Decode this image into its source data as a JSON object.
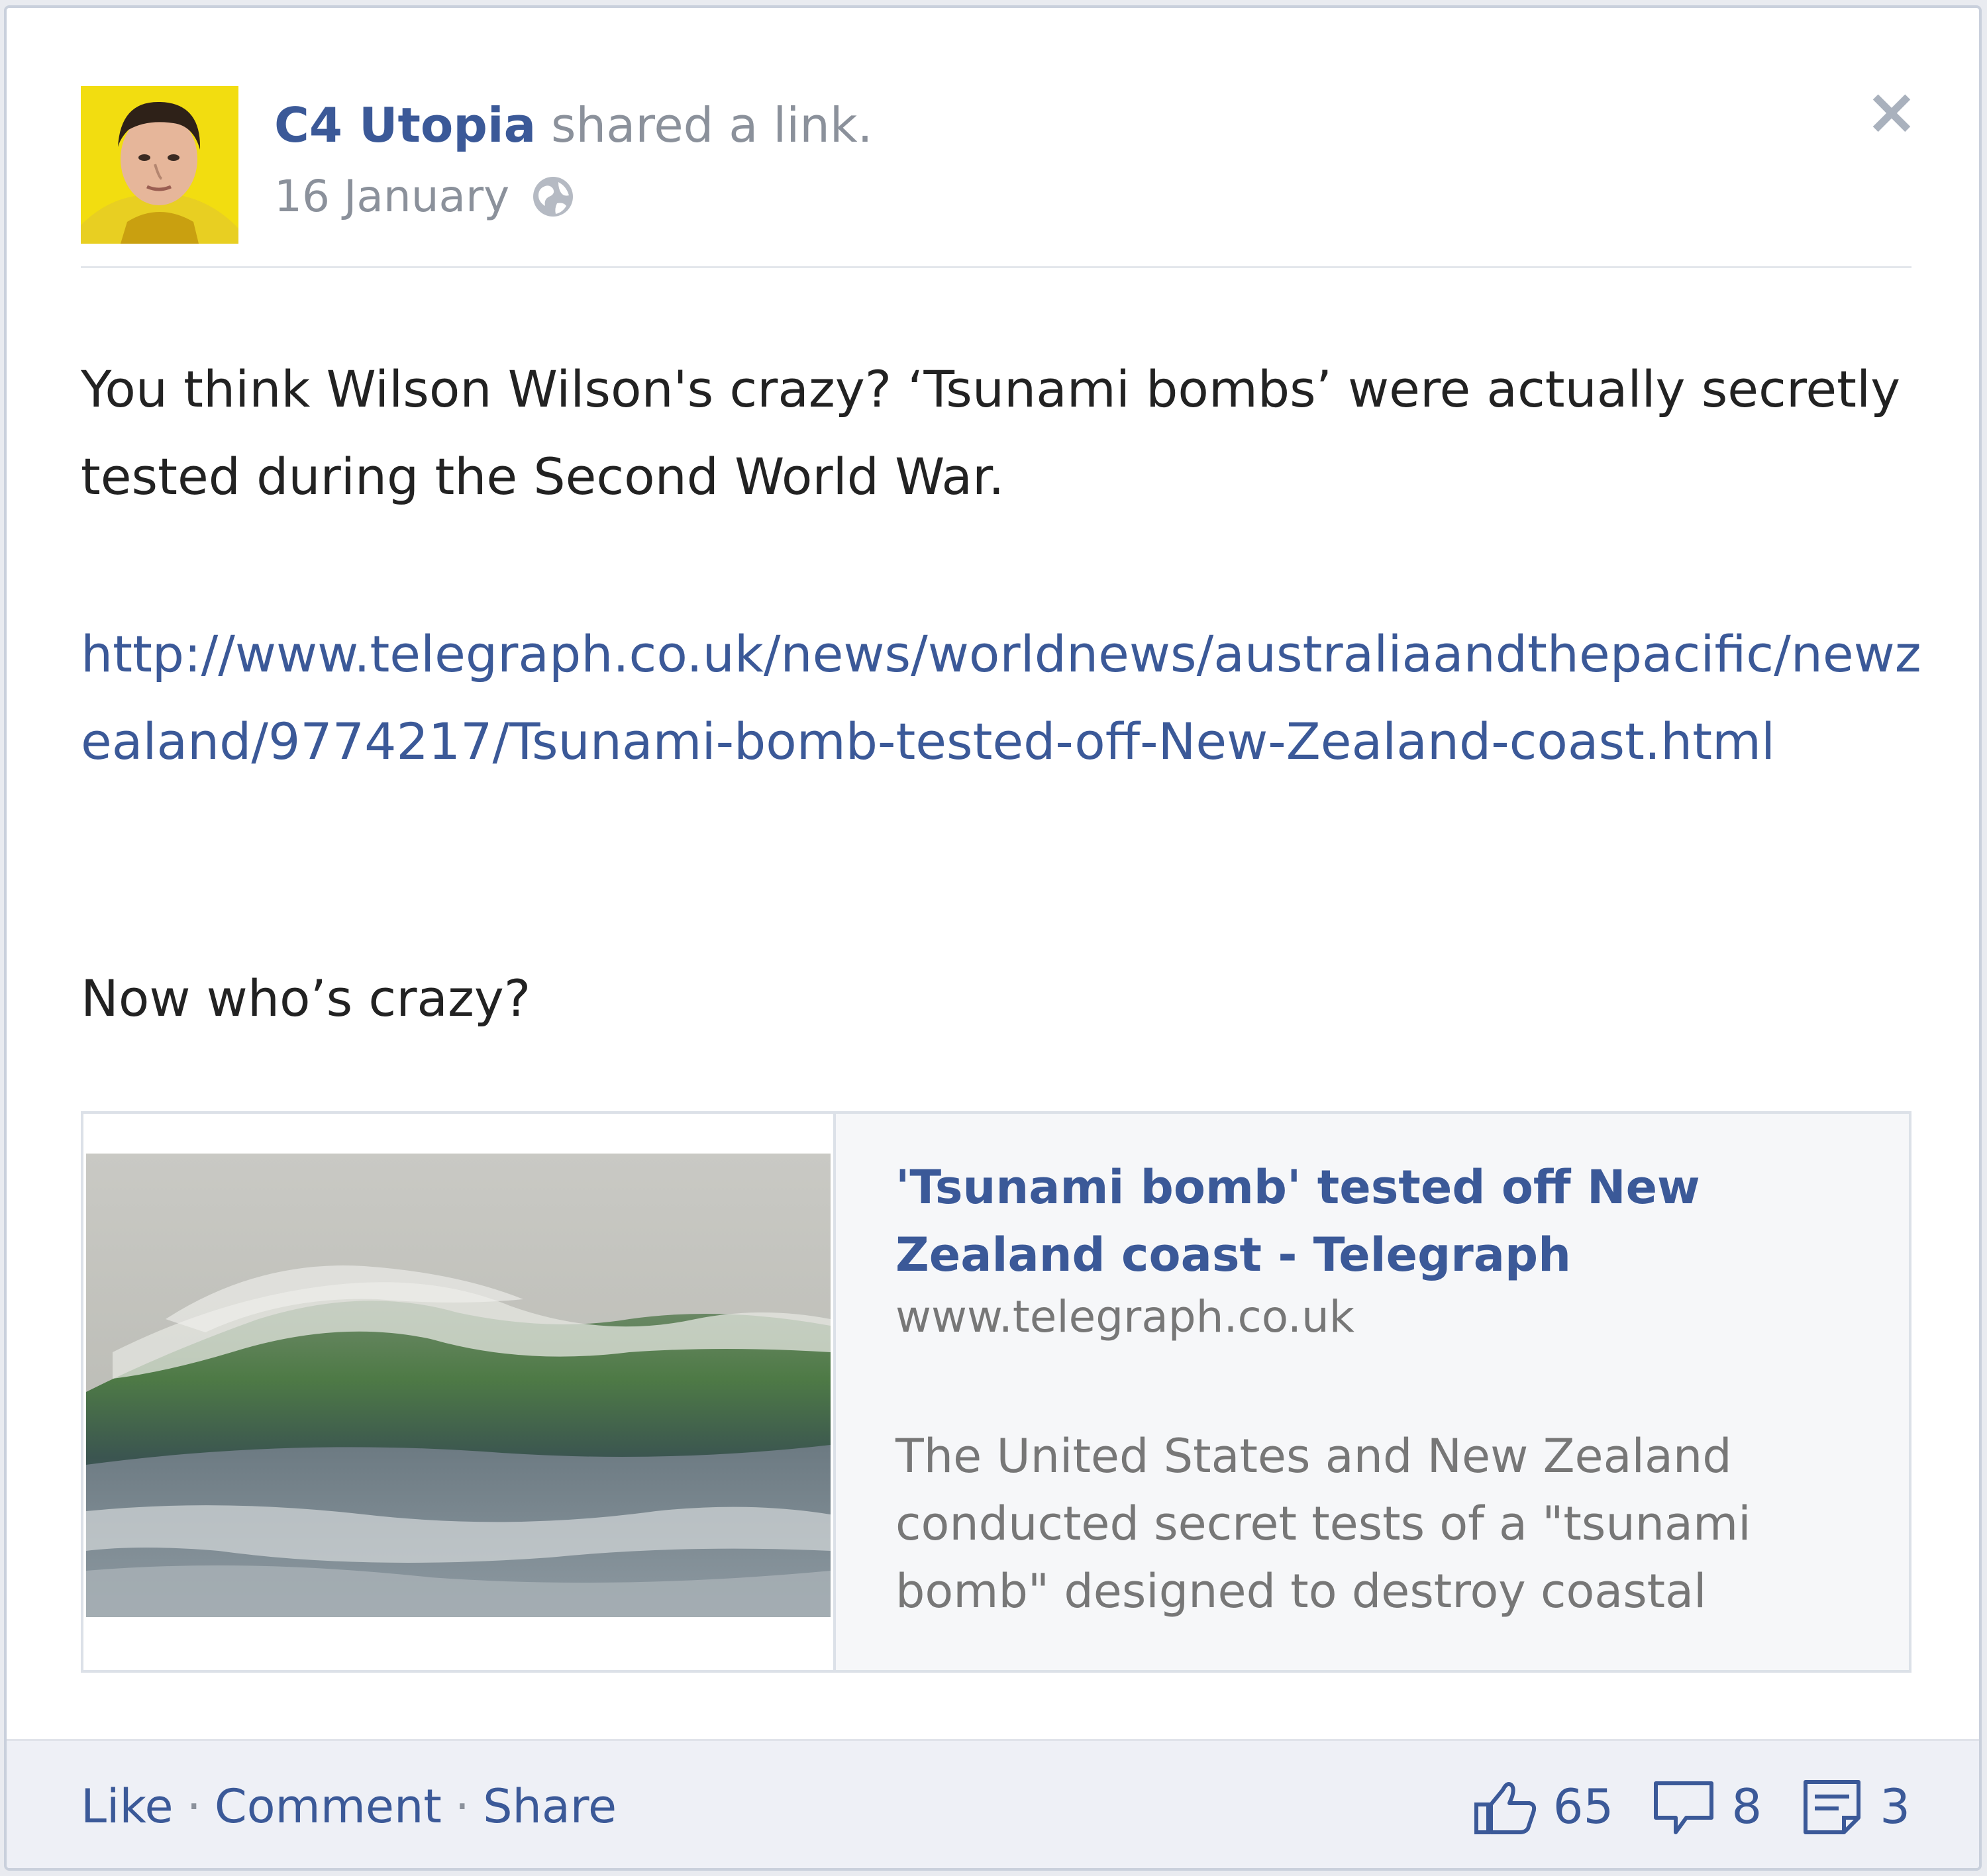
{
  "post": {
    "author": "C4 Utopia",
    "action": "shared a link.",
    "date": "16 January",
    "privacy_icon": "globe-icon",
    "close_icon": "close-icon",
    "close_symbol": "×"
  },
  "message": {
    "line1": "You think Wilson Wilson's crazy? ‘Tsunami bombs’ were actually secretly tested during the Second World War.",
    "url": "http://www.telegraph.co.uk/news/worldnews/australiaandthepacific/newzealand/9774217/Tsunami-bomb-tested-off-New-Zealand-coast.html",
    "line2": "Now who’s crazy?"
  },
  "attachment": {
    "title": "'Tsunami bomb' tested off New Zealand coast - Telegraph",
    "domain": "www.telegraph.co.uk",
    "description": "The United States and New Zealand conducted secret tests of a \"tsunami bomb\" designed to destroy coastal"
  },
  "footer": {
    "like": "Like",
    "comment": "Comment",
    "share": "Share",
    "separator": "·",
    "likes_count": "65",
    "comments_count": "8",
    "shares_count": "3"
  },
  "colors": {
    "link_blue": "#3b5998",
    "muted_gray": "#8b919b",
    "footer_bg": "#eef0f6",
    "avatar_bg": "#f2dd10"
  }
}
